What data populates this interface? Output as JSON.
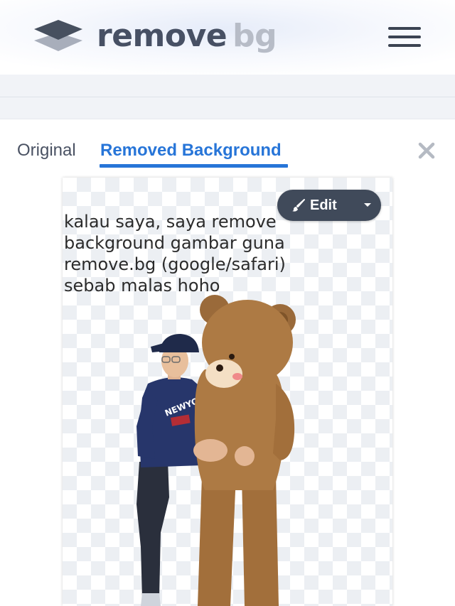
{
  "header": {
    "logo_word1": "remove",
    "logo_word2": "bg",
    "logo_icon": "layers-icon",
    "menu_icon": "hamburger-menu-icon"
  },
  "tabs": [
    {
      "label": "Original",
      "active": false
    },
    {
      "label": "Removed Background",
      "active": true
    }
  ],
  "close_icon": "close-icon",
  "preview": {
    "caption": "kalau saya, saya remove\nbackground gambar  guna\nremove.bg (google/safari)\nsebab malas hoho",
    "background": "transparent-checkerboard",
    "edit": {
      "label": "Edit",
      "icon": "brush-icon",
      "menu_icon": "caret-down-icon"
    }
  },
  "colors": {
    "accent": "#2775d8",
    "logo_dark": "#475064",
    "logo_light": "#b7bcc7",
    "edit_button": "#404a5a"
  }
}
